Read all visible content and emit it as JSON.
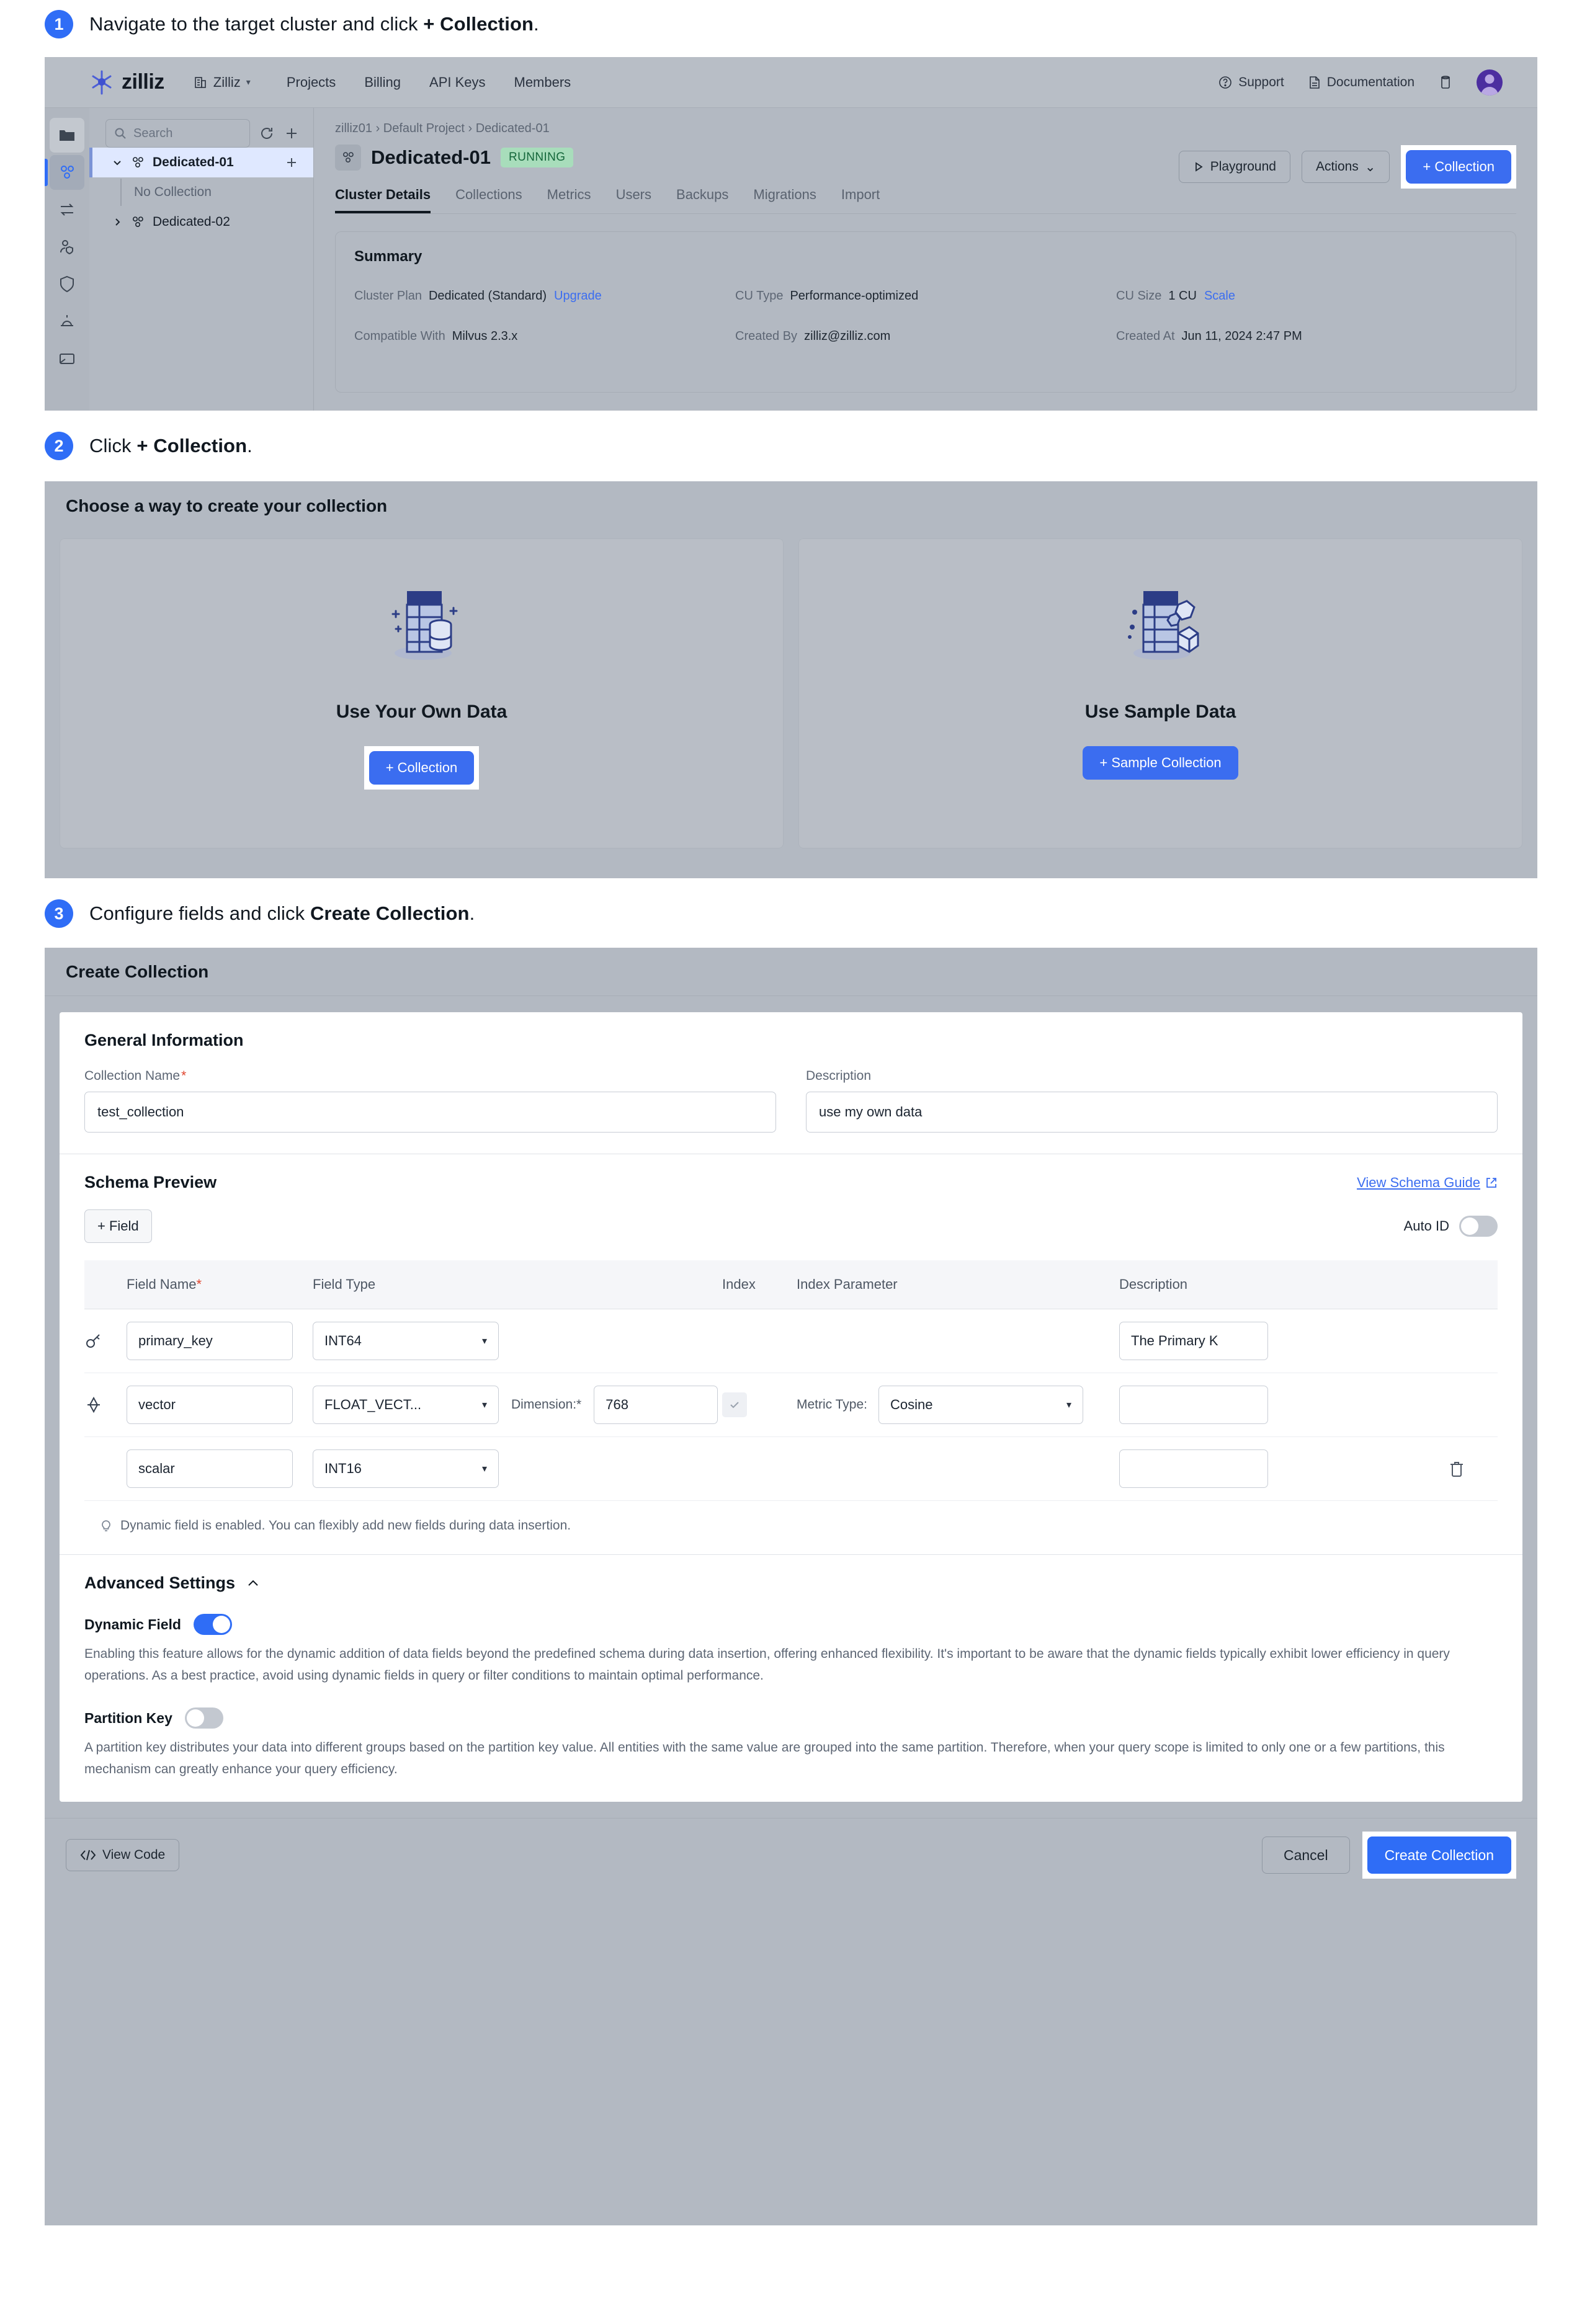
{
  "steps": [
    {
      "num": "1",
      "pre": "Navigate to the target cluster and click ",
      "bold": "+ Collection",
      "post": "."
    },
    {
      "num": "2",
      "pre": "Click ",
      "bold": "+ Collection",
      "post": "."
    },
    {
      "num": "3",
      "pre": "Configure fields and click ",
      "bold": "Create Collection",
      "post": "."
    }
  ],
  "console": {
    "brand": "zilliz",
    "org": "Zilliz",
    "org_caret": "▾",
    "topnav": [
      "Projects",
      "Billing",
      "API Keys",
      "Members"
    ],
    "support": "Support",
    "documentation": "Documentation",
    "sidebar": {
      "search_placeholder": "Search",
      "refresh_icon": "refresh-icon",
      "add_icon": "plus-icon",
      "cluster_1": "Dedicated-01",
      "no_collection": "No Collection",
      "cluster_2": "Dedicated-02"
    },
    "breadcrumb": "zilliz01 › Default Project › Dedicated-01",
    "cluster_name": "Dedicated-01",
    "status": "RUNNING",
    "buttons": {
      "playground": "Playground",
      "actions": "Actions",
      "actions_caret": "⌄",
      "add_collection": "+ Collection"
    },
    "tabs": [
      "Cluster Details",
      "Collections",
      "Metrics",
      "Users",
      "Backups",
      "Migrations",
      "Import"
    ],
    "active_tab": "Cluster Details",
    "summary": {
      "title": "Summary",
      "rows": [
        {
          "key": "Cluster Plan",
          "value": "Dedicated (Standard)",
          "link": "Upgrade"
        },
        {
          "key": "CU Type",
          "value": "Performance-optimized",
          "link": ""
        },
        {
          "key": "CU Size",
          "value": "1 CU",
          "link": "Scale"
        },
        {
          "key": "Compatible With",
          "value": "Milvus 2.3.x",
          "link": ""
        },
        {
          "key": "Created By",
          "value": "zilliz@zilliz.com",
          "link": ""
        },
        {
          "key": "Created At",
          "value": "Jun 11, 2024 2:47 PM",
          "link": ""
        }
      ]
    }
  },
  "choose": {
    "title": "Choose a way to create your collection",
    "cards": [
      {
        "title": "Use Your Own Data",
        "button": "+ Collection",
        "icon": "table-database-icon",
        "highlighted": true
      },
      {
        "title": "Use Sample Data",
        "button": "+ Sample Collection",
        "icon": "table-cubes-icon",
        "highlighted": false
      }
    ]
  },
  "dialog": {
    "title": "Create Collection",
    "general": {
      "title": "General Information",
      "name_label": "Collection Name",
      "name_required": "*",
      "name_value": "test_collection",
      "desc_label": "Description",
      "desc_value": "use my own data"
    },
    "schema": {
      "title": "Schema Preview",
      "guide_link": "View Schema Guide",
      "guide_icon": "external-link-icon",
      "add_field": "+ Field",
      "auto_id_label": "Auto ID",
      "auto_id_on": false,
      "columns": [
        "Field Name",
        "Field Type",
        "Index",
        "Index Parameter",
        "Description"
      ],
      "name_required": "*",
      "rows": [
        {
          "icon": "key-icon",
          "name": "primary_key",
          "type": "INT64",
          "dimension_label": "",
          "dimension": "",
          "metric_label": "",
          "metric": "",
          "description": "The Primary K",
          "deletable": false,
          "has_index": false
        },
        {
          "icon": "vector-icon",
          "name": "vector",
          "type": "FLOAT_VECT...",
          "dimension_label": "Dimension:",
          "dimension_required": "*",
          "dimension": "768",
          "metric_label": "Metric Type:",
          "metric": "Cosine",
          "description": "",
          "deletable": false,
          "has_index": true
        },
        {
          "icon": "",
          "name": "scalar",
          "type": "INT16",
          "dimension_label": "",
          "dimension": "",
          "metric_label": "",
          "metric": "",
          "description": "",
          "deletable": true,
          "has_index": false
        }
      ],
      "hint_icon": "lightbulb-icon",
      "hint": "Dynamic field is enabled. You can flexibly add new fields during data insertion."
    },
    "advanced": {
      "title": "Advanced Settings",
      "collapse_icon": "chevron-up-icon",
      "dynamic_field": {
        "label": "Dynamic Field",
        "on": true,
        "description": "Enabling this feature allows for the dynamic addition of data fields beyond the predefined schema during data insertion, offering enhanced flexibility. It's important to be aware that the dynamic fields typically exhibit lower efficiency in query operations. As a best practice, avoid using dynamic fields in query or filter conditions to maintain optimal performance."
      },
      "partition_key": {
        "label": "Partition Key",
        "on": false,
        "description": "A partition key distributes your data into different groups based on the partition key value. All entities with the same value are grouped into the same partition. Therefore, when your query scope is limited to only one or a few partitions, this mechanism can greatly enhance your query efficiency."
      }
    },
    "footer": {
      "view_code": "View Code",
      "view_code_icon": "code-icon",
      "cancel": "Cancel",
      "create": "Create Collection"
    }
  },
  "colors": {
    "accent": "#2f6df6",
    "primary_button": "#3b6df0",
    "running_badge_bg": "#a8ddbb",
    "running_badge_text": "#14663a",
    "required": "#e0452e"
  }
}
